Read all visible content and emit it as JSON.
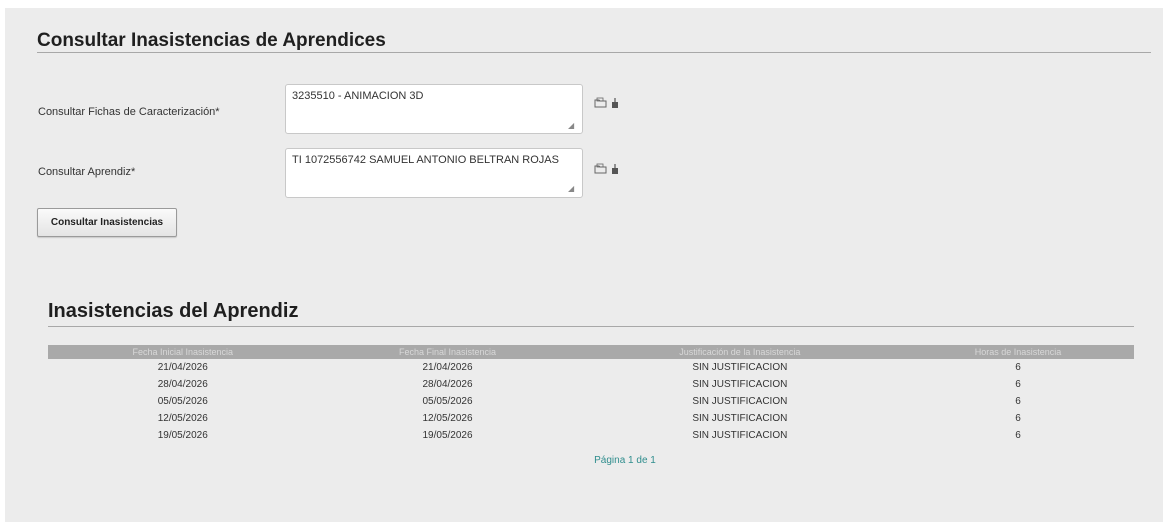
{
  "form": {
    "title": "Consultar Inasistencias de Aprendices",
    "fichas_label": "Consultar Fichas de Caracterización*",
    "fichas_value": "3235510 - ANIMACION 3D",
    "aprendiz_label": "Consultar Aprendiz*",
    "aprendiz_value": "TI 1072556742 SAMUEL ANTONIO BELTRAN ROJAS",
    "consultar_button": "Consultar Inasistencias",
    "icons": [
      "folder-search-icon",
      "eraser-icon"
    ]
  },
  "results": {
    "title": "Inasistencias del Aprendiz",
    "columns": [
      "Fecha Inicial Inasistencia",
      "Fecha Final Inasistencia",
      "Justificación de la Inasistencia",
      "Horas de Inasistencia"
    ],
    "rows": [
      [
        "21/04/2026",
        "21/04/2026",
        "SIN JUSTIFICACION",
        "6"
      ],
      [
        "28/04/2026",
        "28/04/2026",
        "SIN JUSTIFICACION",
        "6"
      ],
      [
        "05/05/2026",
        "05/05/2026",
        "SIN JUSTIFICACION",
        "6"
      ],
      [
        "12/05/2026",
        "12/05/2026",
        "SIN JUSTIFICACION",
        "6"
      ],
      [
        "19/05/2026",
        "19/05/2026",
        "SIN JUSTIFICACION",
        "6"
      ]
    ],
    "pager": "Página 1 de 1"
  },
  "colors": {
    "panel_bg": "#ececec",
    "header_bg": "#a9a9a9",
    "pager_link": "#2f8d8d"
  }
}
